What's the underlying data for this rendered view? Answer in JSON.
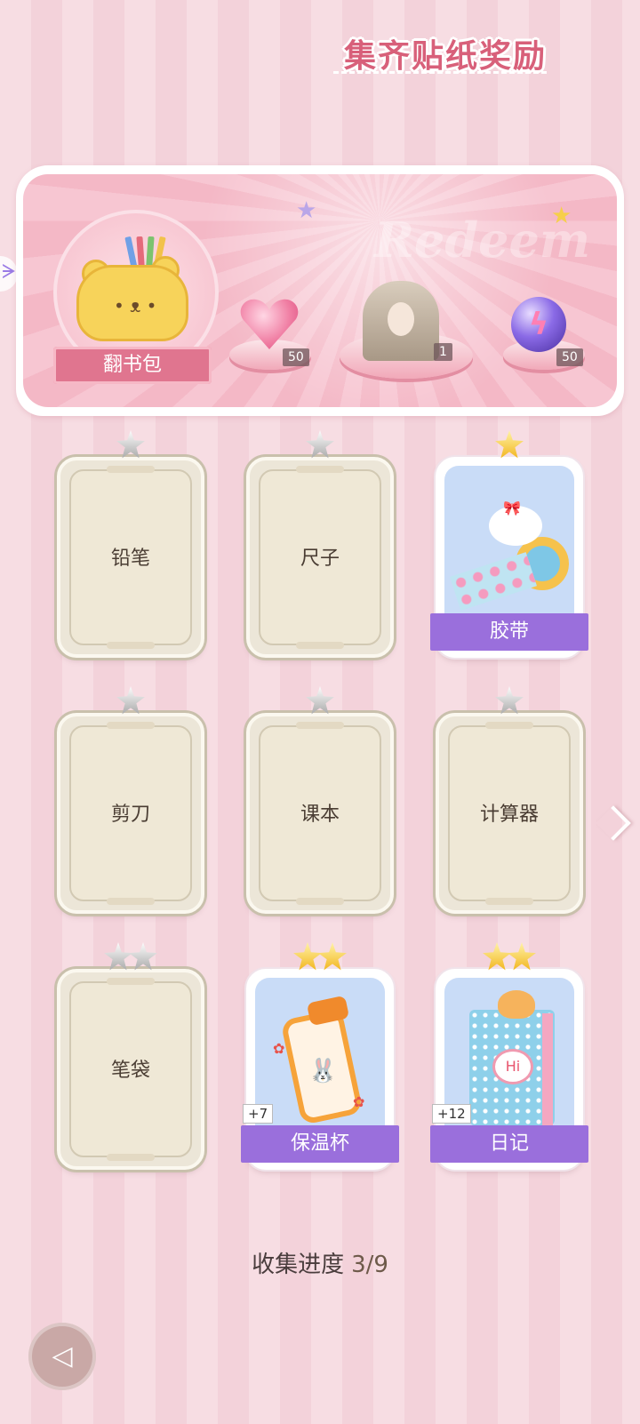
{
  "banner": {
    "title": "集齐贴纸奖励",
    "bag_label": "翻书包",
    "rewards": [
      {
        "name": "pink-diamond",
        "count": "50"
      },
      {
        "name": "outfit-portrait",
        "count": "1"
      },
      {
        "name": "energy-orb",
        "count": "50"
      }
    ]
  },
  "stickers": [
    {
      "label": "铅笔",
      "stars": 1,
      "collected": false
    },
    {
      "label": "尺子",
      "stars": 1,
      "collected": false
    },
    {
      "label": "胶带",
      "stars": 1,
      "collected": true
    },
    {
      "label": "剪刀",
      "stars": 1,
      "collected": false
    },
    {
      "label": "课本",
      "stars": 1,
      "collected": false
    },
    {
      "label": "计算器",
      "stars": 1,
      "collected": false
    },
    {
      "label": "笔袋",
      "stars": 2,
      "collected": false
    },
    {
      "label": "保温杯",
      "stars": 2,
      "collected": true,
      "bonus": "+7"
    },
    {
      "label": "日记",
      "stars": 2,
      "collected": true,
      "bonus": "+12"
    }
  ],
  "progress": {
    "label": "收集进度",
    "value": "3/9"
  },
  "colors": {
    "ribbon": "#9a6fdc",
    "bag_label": "#e0758f",
    "gold_star": "#f2b61f",
    "silver_star": "#a9a9a9"
  }
}
